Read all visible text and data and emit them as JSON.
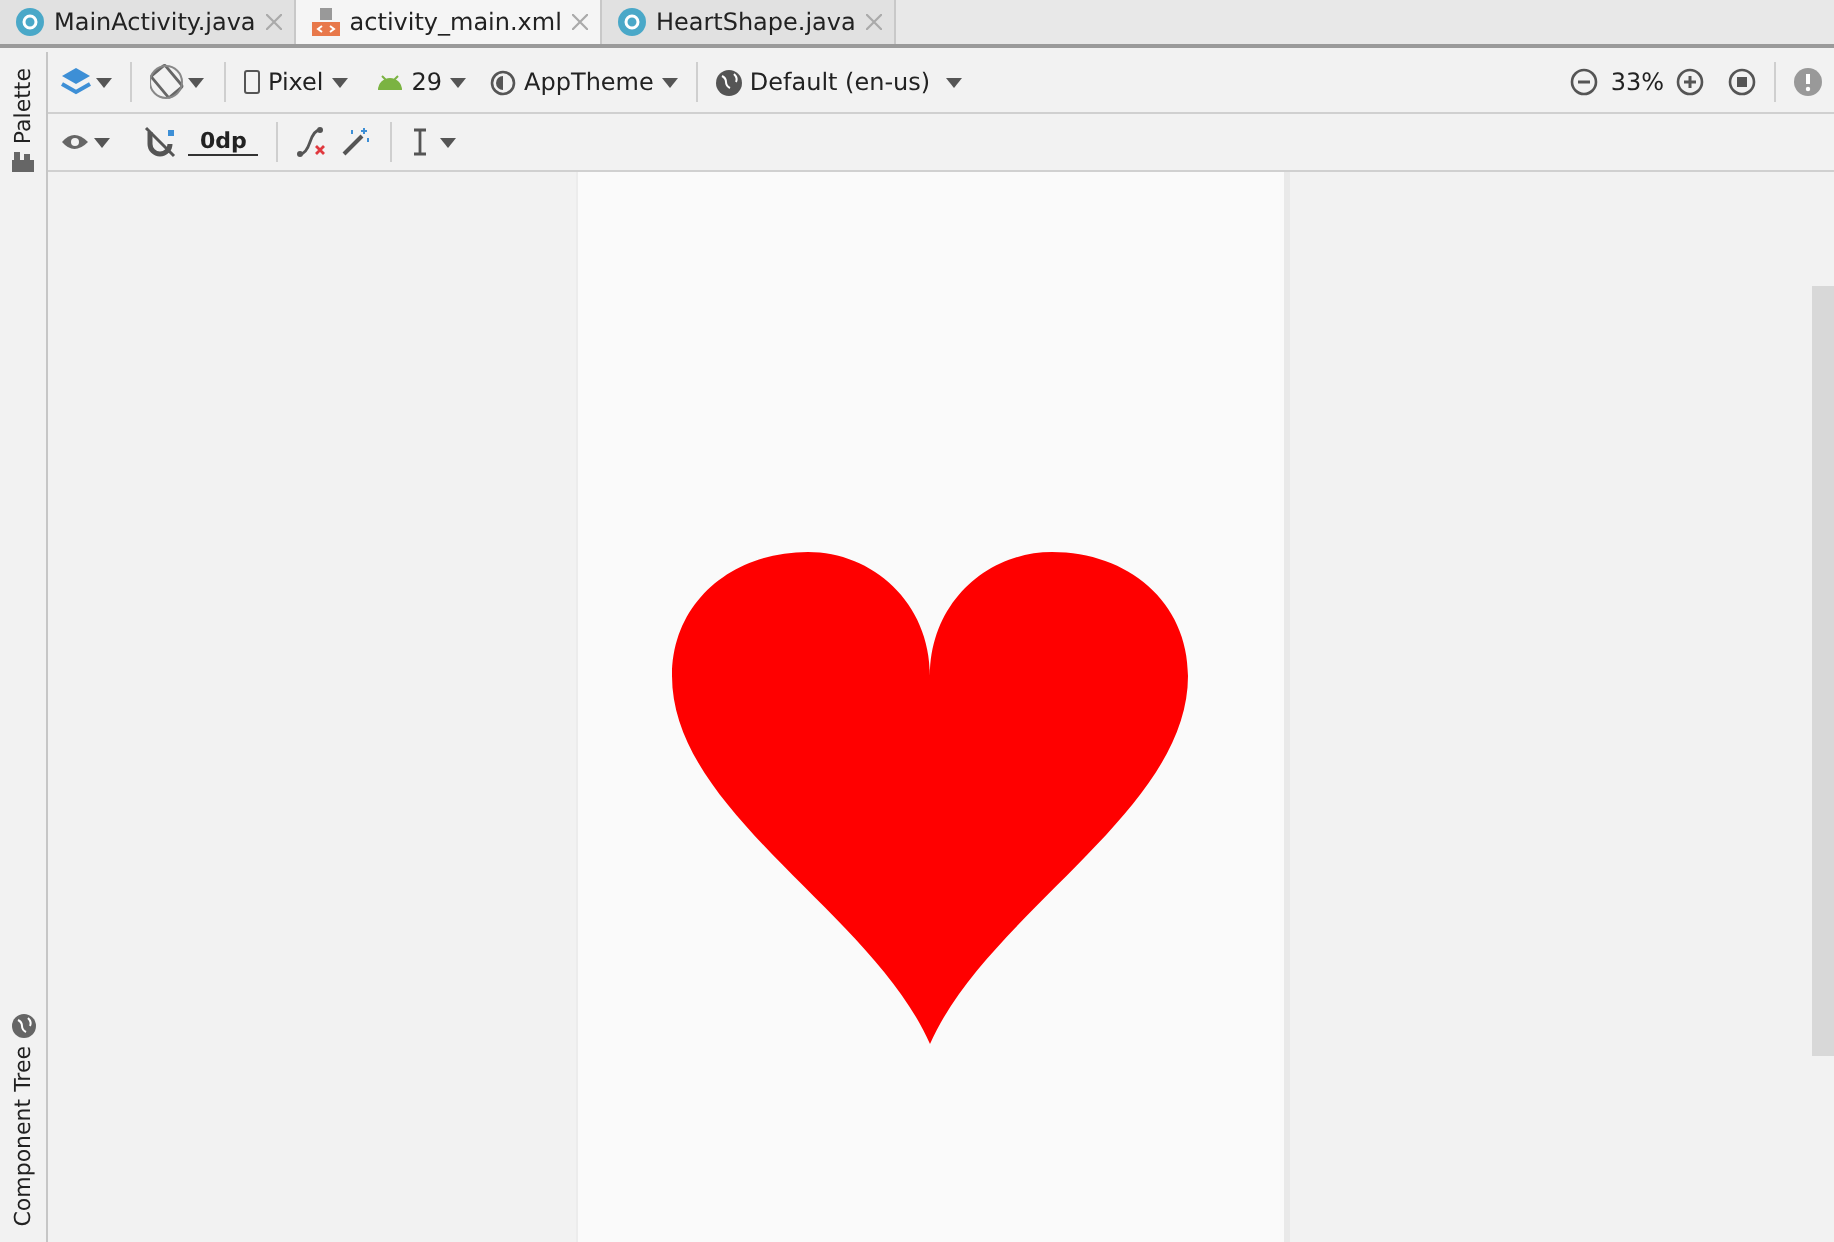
{
  "tabs": [
    {
      "label": "MainActivity.java",
      "kind": "class",
      "selected": false
    },
    {
      "label": "activity_main.xml",
      "kind": "layout",
      "selected": true
    },
    {
      "label": "HeartShape.java",
      "kind": "class",
      "selected": false
    }
  ],
  "toolbar": {
    "device": "Pixel",
    "api": "29",
    "theme": "AppTheme",
    "locale": "Default (en-us)",
    "zoom": "33%"
  },
  "secondary_toolbar": {
    "margin": "0dp"
  },
  "side_panels": {
    "top": "Palette",
    "bottom": "Component Tree"
  }
}
